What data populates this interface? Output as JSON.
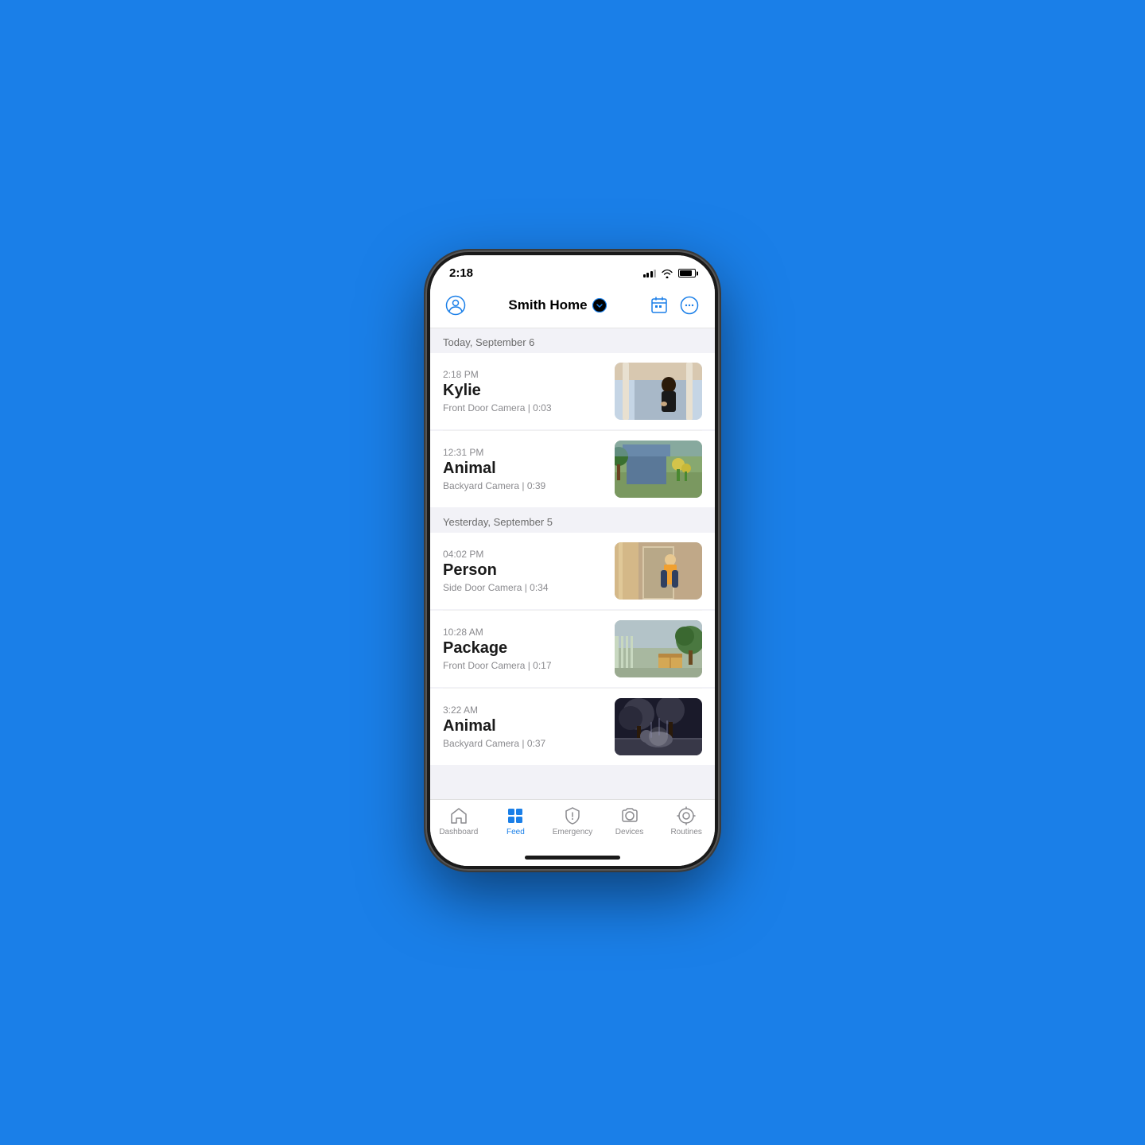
{
  "page": {
    "background_color": "#1a7fe8"
  },
  "status_bar": {
    "time": "2:18",
    "signal_label": "signal",
    "wifi_label": "wifi",
    "battery_label": "battery"
  },
  "top_nav": {
    "title": "Smith Home",
    "chevron": "▾",
    "profile_icon": "person",
    "calendar_icon": "calendar",
    "more_icon": "more"
  },
  "sections": [
    {
      "id": "today",
      "label": "Today, September 6",
      "items": [
        {
          "id": "kylie",
          "time": "2:18 PM",
          "title": "Kylie",
          "subtitle": "Front Door Camera | 0:03",
          "thumb_type": "kylie"
        },
        {
          "id": "animal1",
          "time": "12:31 PM",
          "title": "Animal",
          "subtitle": "Backyard Camera | 0:39",
          "thumb_type": "animal"
        }
      ]
    },
    {
      "id": "yesterday",
      "label": "Yesterday, September 5",
      "items": [
        {
          "id": "person",
          "time": "04:02 PM",
          "title": "Person",
          "subtitle": "Side Door Camera | 0:34",
          "thumb_type": "person"
        },
        {
          "id": "package",
          "time": "10:28 AM",
          "title": "Package",
          "subtitle": "Front Door Camera | 0:17",
          "thumb_type": "package"
        },
        {
          "id": "animal2",
          "time": "3:22 AM",
          "title": "Animal",
          "subtitle": "Backyard Camera | 0:37",
          "thumb_type": "animal2"
        }
      ]
    }
  ],
  "tabs": [
    {
      "id": "dashboard",
      "label": "Dashboard",
      "icon": "house",
      "active": false
    },
    {
      "id": "feed",
      "label": "Feed",
      "icon": "feed",
      "active": true
    },
    {
      "id": "emergency",
      "label": "Emergency",
      "icon": "shield",
      "active": false
    },
    {
      "id": "devices",
      "label": "Devices",
      "icon": "camera",
      "active": false
    },
    {
      "id": "routines",
      "label": "Routines",
      "icon": "routines",
      "active": false
    }
  ]
}
